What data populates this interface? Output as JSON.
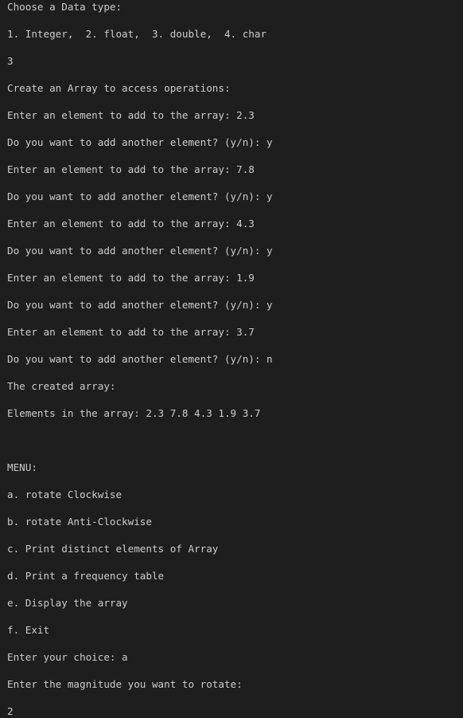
{
  "terminal": {
    "lines": [
      "Choose a Data type:",
      "1. Integer,  2. float,  3. double,  4. char",
      "3",
      "Create an Array to access operations:",
      "Enter an element to add to the array: 2.3",
      "Do you want to add another element? (y/n): y",
      "Enter an element to add to the array: 7.8",
      "Do you want to add another element? (y/n): y",
      "Enter an element to add to the array: 4.3",
      "Do you want to add another element? (y/n): y",
      "Enter an element to add to the array: 1.9",
      "Do you want to add another element? (y/n): y",
      "Enter an element to add to the array: 3.7",
      "Do you want to add another element? (y/n): n",
      "The created array:",
      "Elements in the array: 2.3 7.8 4.3 1.9 3.7",
      "",
      "MENU:",
      "a. rotate Clockwise",
      "b. rotate Anti-Clockwise",
      "c. Print distinct elements of Array",
      "d. Print a frequency table",
      "e. Display the array",
      "f. Exit",
      "Enter your choice: a",
      "Enter the magnitude you want to rotate:",
      "2"
    ]
  }
}
